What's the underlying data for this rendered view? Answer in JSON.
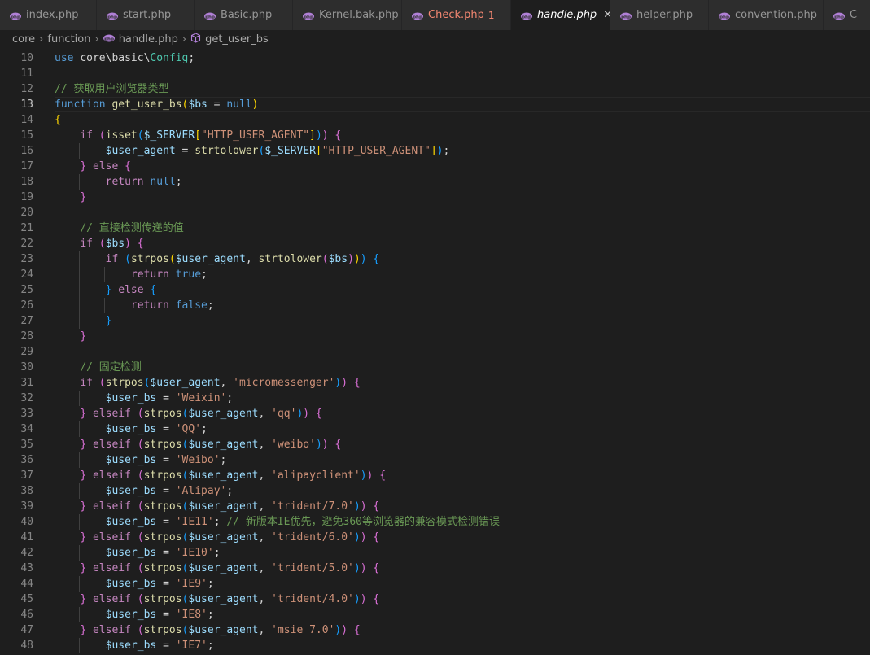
{
  "tabs": [
    {
      "label": "index.php",
      "active": false,
      "error": false
    },
    {
      "label": "start.php",
      "active": false,
      "error": false
    },
    {
      "label": "Basic.php",
      "active": false,
      "error": false
    },
    {
      "label": "Kernel.bak.php",
      "active": false,
      "error": false
    },
    {
      "label": "Check.php",
      "active": false,
      "error": true,
      "badge": "1"
    },
    {
      "label": "handle.php",
      "active": true,
      "error": false,
      "close": "✕"
    },
    {
      "label": "helper.php",
      "active": false,
      "error": false
    },
    {
      "label": "convention.php",
      "active": false,
      "error": false
    },
    {
      "label": "C",
      "active": false,
      "error": false
    }
  ],
  "breadcrumb": {
    "root": "core",
    "folder": "function",
    "file": "handle.php",
    "symbol": "get_user_bs"
  },
  "editor": {
    "current_line": 13,
    "lines": [
      {
        "n": "10",
        "t": [
          [
            "use ",
            "kw"
          ],
          [
            "core\\basic\\",
            "op"
          ],
          [
            "Config",
            "cls"
          ],
          [
            ";",
            "op"
          ]
        ]
      },
      {
        "n": "11",
        "t": []
      },
      {
        "n": "12",
        "t": [
          [
            "// 获取用户浏览器类型",
            "cmt"
          ]
        ]
      },
      {
        "n": "13",
        "t": [
          [
            "function ",
            "kw"
          ],
          [
            "get_user_bs",
            "fn"
          ],
          [
            "(",
            "p0"
          ],
          [
            "$bs",
            "var"
          ],
          [
            " = ",
            "op"
          ],
          [
            "null",
            "kw"
          ],
          [
            ")",
            "p0"
          ]
        ]
      },
      {
        "n": "14",
        "t": [
          [
            "{",
            "p0"
          ]
        ]
      },
      {
        "n": "15",
        "t": [
          [
            "    ",
            "op"
          ],
          [
            "if ",
            "ctl"
          ],
          [
            "(",
            "p1"
          ],
          [
            "isset",
            "fn"
          ],
          [
            "(",
            "p2"
          ],
          [
            "$_SERVER",
            "var"
          ],
          [
            "[",
            "p0"
          ],
          [
            "\"HTTP_USER_AGENT\"",
            "str"
          ],
          [
            "]",
            "p0"
          ],
          [
            ")",
            "p2"
          ],
          [
            ")",
            "p1"
          ],
          [
            " {",
            "p1"
          ]
        ]
      },
      {
        "n": "16",
        "t": [
          [
            "        ",
            "op"
          ],
          [
            "$user_agent",
            "var"
          ],
          [
            " = ",
            "op"
          ],
          [
            "strtolower",
            "fn"
          ],
          [
            "(",
            "p2"
          ],
          [
            "$_SERVER",
            "var"
          ],
          [
            "[",
            "p0"
          ],
          [
            "\"HTTP_USER_AGENT\"",
            "str"
          ],
          [
            "]",
            "p0"
          ],
          [
            ")",
            "p2"
          ],
          [
            ";",
            "op"
          ]
        ]
      },
      {
        "n": "17",
        "t": [
          [
            "    ",
            "op"
          ],
          [
            "}",
            "p1"
          ],
          [
            " else ",
            "ctl"
          ],
          [
            "{",
            "p1"
          ]
        ]
      },
      {
        "n": "18",
        "t": [
          [
            "        ",
            "op"
          ],
          [
            "return ",
            "ctl"
          ],
          [
            "null",
            "kw"
          ],
          [
            ";",
            "op"
          ]
        ]
      },
      {
        "n": "19",
        "t": [
          [
            "    ",
            "op"
          ],
          [
            "}",
            "p1"
          ]
        ]
      },
      {
        "n": "20",
        "t": []
      },
      {
        "n": "21",
        "t": [
          [
            "    ",
            "op"
          ],
          [
            "// 直接检测传递的值",
            "cmt"
          ]
        ]
      },
      {
        "n": "22",
        "t": [
          [
            "    ",
            "op"
          ],
          [
            "if ",
            "ctl"
          ],
          [
            "(",
            "p1"
          ],
          [
            "$bs",
            "var"
          ],
          [
            ")",
            "p1"
          ],
          [
            " {",
            "p1"
          ]
        ]
      },
      {
        "n": "23",
        "t": [
          [
            "        ",
            "op"
          ],
          [
            "if ",
            "ctl"
          ],
          [
            "(",
            "p2"
          ],
          [
            "strpos",
            "fn"
          ],
          [
            "(",
            "p0"
          ],
          [
            "$user_agent",
            "var"
          ],
          [
            ", ",
            "op"
          ],
          [
            "strtolower",
            "fn"
          ],
          [
            "(",
            "p1"
          ],
          [
            "$bs",
            "var"
          ],
          [
            ")",
            "p1"
          ],
          [
            ")",
            "p0"
          ],
          [
            ")",
            "p2"
          ],
          [
            " {",
            "p2"
          ]
        ]
      },
      {
        "n": "24",
        "t": [
          [
            "            ",
            "op"
          ],
          [
            "return ",
            "ctl"
          ],
          [
            "true",
            "kw"
          ],
          [
            ";",
            "op"
          ]
        ]
      },
      {
        "n": "25",
        "t": [
          [
            "        ",
            "op"
          ],
          [
            "}",
            "p2"
          ],
          [
            " else ",
            "ctl"
          ],
          [
            "{",
            "p2"
          ]
        ]
      },
      {
        "n": "26",
        "t": [
          [
            "            ",
            "op"
          ],
          [
            "return ",
            "ctl"
          ],
          [
            "false",
            "kw"
          ],
          [
            ";",
            "op"
          ]
        ]
      },
      {
        "n": "27",
        "t": [
          [
            "        ",
            "op"
          ],
          [
            "}",
            "p2"
          ]
        ]
      },
      {
        "n": "28",
        "t": [
          [
            "    ",
            "op"
          ],
          [
            "}",
            "p1"
          ]
        ]
      },
      {
        "n": "29",
        "t": []
      },
      {
        "n": "30",
        "t": [
          [
            "    ",
            "op"
          ],
          [
            "// 固定检测",
            "cmt"
          ]
        ]
      },
      {
        "n": "31",
        "t": [
          [
            "    ",
            "op"
          ],
          [
            "if ",
            "ctl"
          ],
          [
            "(",
            "p1"
          ],
          [
            "strpos",
            "fn"
          ],
          [
            "(",
            "p2"
          ],
          [
            "$user_agent",
            "var"
          ],
          [
            ", ",
            "op"
          ],
          [
            "'micromessenger'",
            "str"
          ],
          [
            ")",
            "p2"
          ],
          [
            ")",
            "p1"
          ],
          [
            " {",
            "p1"
          ]
        ]
      },
      {
        "n": "32",
        "t": [
          [
            "        ",
            "op"
          ],
          [
            "$user_bs",
            "var"
          ],
          [
            " = ",
            "op"
          ],
          [
            "'Weixin'",
            "str"
          ],
          [
            ";",
            "op"
          ]
        ]
      },
      {
        "n": "33",
        "t": [
          [
            "    ",
            "op"
          ],
          [
            "}",
            "p1"
          ],
          [
            " elseif ",
            "ctl"
          ],
          [
            "(",
            "p1"
          ],
          [
            "strpos",
            "fn"
          ],
          [
            "(",
            "p2"
          ],
          [
            "$user_agent",
            "var"
          ],
          [
            ", ",
            "op"
          ],
          [
            "'qq'",
            "str"
          ],
          [
            ")",
            "p2"
          ],
          [
            ")",
            "p1"
          ],
          [
            " {",
            "p1"
          ]
        ]
      },
      {
        "n": "34",
        "t": [
          [
            "        ",
            "op"
          ],
          [
            "$user_bs",
            "var"
          ],
          [
            " = ",
            "op"
          ],
          [
            "'QQ'",
            "str"
          ],
          [
            ";",
            "op"
          ]
        ]
      },
      {
        "n": "35",
        "t": [
          [
            "    ",
            "op"
          ],
          [
            "}",
            "p1"
          ],
          [
            " elseif ",
            "ctl"
          ],
          [
            "(",
            "p1"
          ],
          [
            "strpos",
            "fn"
          ],
          [
            "(",
            "p2"
          ],
          [
            "$user_agent",
            "var"
          ],
          [
            ", ",
            "op"
          ],
          [
            "'weibo'",
            "str"
          ],
          [
            ")",
            "p2"
          ],
          [
            ")",
            "p1"
          ],
          [
            " {",
            "p1"
          ]
        ]
      },
      {
        "n": "36",
        "t": [
          [
            "        ",
            "op"
          ],
          [
            "$user_bs",
            "var"
          ],
          [
            " = ",
            "op"
          ],
          [
            "'Weibo'",
            "str"
          ],
          [
            ";",
            "op"
          ]
        ]
      },
      {
        "n": "37",
        "t": [
          [
            "    ",
            "op"
          ],
          [
            "}",
            "p1"
          ],
          [
            " elseif ",
            "ctl"
          ],
          [
            "(",
            "p1"
          ],
          [
            "strpos",
            "fn"
          ],
          [
            "(",
            "p2"
          ],
          [
            "$user_agent",
            "var"
          ],
          [
            ", ",
            "op"
          ],
          [
            "'alipayclient'",
            "str"
          ],
          [
            ")",
            "p2"
          ],
          [
            ")",
            "p1"
          ],
          [
            " {",
            "p1"
          ]
        ]
      },
      {
        "n": "38",
        "t": [
          [
            "        ",
            "op"
          ],
          [
            "$user_bs",
            "var"
          ],
          [
            " = ",
            "op"
          ],
          [
            "'Alipay'",
            "str"
          ],
          [
            ";",
            "op"
          ]
        ]
      },
      {
        "n": "39",
        "t": [
          [
            "    ",
            "op"
          ],
          [
            "}",
            "p1"
          ],
          [
            " elseif ",
            "ctl"
          ],
          [
            "(",
            "p1"
          ],
          [
            "strpos",
            "fn"
          ],
          [
            "(",
            "p2"
          ],
          [
            "$user_agent",
            "var"
          ],
          [
            ", ",
            "op"
          ],
          [
            "'trident/7.0'",
            "str"
          ],
          [
            ")",
            "p2"
          ],
          [
            ")",
            "p1"
          ],
          [
            " {",
            "p1"
          ]
        ]
      },
      {
        "n": "40",
        "t": [
          [
            "        ",
            "op"
          ],
          [
            "$user_bs",
            "var"
          ],
          [
            " = ",
            "op"
          ],
          [
            "'IE11'",
            "str"
          ],
          [
            "; ",
            "op"
          ],
          [
            "// 新版本IE优先，避免360等浏览器的兼容模式检测错误",
            "cmt"
          ]
        ]
      },
      {
        "n": "41",
        "t": [
          [
            "    ",
            "op"
          ],
          [
            "}",
            "p1"
          ],
          [
            " elseif ",
            "ctl"
          ],
          [
            "(",
            "p1"
          ],
          [
            "strpos",
            "fn"
          ],
          [
            "(",
            "p2"
          ],
          [
            "$user_agent",
            "var"
          ],
          [
            ", ",
            "op"
          ],
          [
            "'trident/6.0'",
            "str"
          ],
          [
            ")",
            "p2"
          ],
          [
            ")",
            "p1"
          ],
          [
            " {",
            "p1"
          ]
        ]
      },
      {
        "n": "42",
        "t": [
          [
            "        ",
            "op"
          ],
          [
            "$user_bs",
            "var"
          ],
          [
            " = ",
            "op"
          ],
          [
            "'IE10'",
            "str"
          ],
          [
            ";",
            "op"
          ]
        ]
      },
      {
        "n": "43",
        "t": [
          [
            "    ",
            "op"
          ],
          [
            "}",
            "p1"
          ],
          [
            " elseif ",
            "ctl"
          ],
          [
            "(",
            "p1"
          ],
          [
            "strpos",
            "fn"
          ],
          [
            "(",
            "p2"
          ],
          [
            "$user_agent",
            "var"
          ],
          [
            ", ",
            "op"
          ],
          [
            "'trident/5.0'",
            "str"
          ],
          [
            ")",
            "p2"
          ],
          [
            ")",
            "p1"
          ],
          [
            " {",
            "p1"
          ]
        ]
      },
      {
        "n": "44",
        "t": [
          [
            "        ",
            "op"
          ],
          [
            "$user_bs",
            "var"
          ],
          [
            " = ",
            "op"
          ],
          [
            "'IE9'",
            "str"
          ],
          [
            ";",
            "op"
          ]
        ]
      },
      {
        "n": "45",
        "t": [
          [
            "    ",
            "op"
          ],
          [
            "}",
            "p1"
          ],
          [
            " elseif ",
            "ctl"
          ],
          [
            "(",
            "p1"
          ],
          [
            "strpos",
            "fn"
          ],
          [
            "(",
            "p2"
          ],
          [
            "$user_agent",
            "var"
          ],
          [
            ", ",
            "op"
          ],
          [
            "'trident/4.0'",
            "str"
          ],
          [
            ")",
            "p2"
          ],
          [
            ")",
            "p1"
          ],
          [
            " {",
            "p1"
          ]
        ]
      },
      {
        "n": "46",
        "t": [
          [
            "        ",
            "op"
          ],
          [
            "$user_bs",
            "var"
          ],
          [
            " = ",
            "op"
          ],
          [
            "'IE8'",
            "str"
          ],
          [
            ";",
            "op"
          ]
        ]
      },
      {
        "n": "47",
        "t": [
          [
            "    ",
            "op"
          ],
          [
            "}",
            "p1"
          ],
          [
            " elseif ",
            "ctl"
          ],
          [
            "(",
            "p1"
          ],
          [
            "strpos",
            "fn"
          ],
          [
            "(",
            "p2"
          ],
          [
            "$user_agent",
            "var"
          ],
          [
            ", ",
            "op"
          ],
          [
            "'msie 7.0'",
            "str"
          ],
          [
            ")",
            "p2"
          ],
          [
            ")",
            "p1"
          ],
          [
            " {",
            "p1"
          ]
        ]
      },
      {
        "n": "48",
        "t": [
          [
            "        ",
            "op"
          ],
          [
            "$user_bs",
            "var"
          ],
          [
            " = ",
            "op"
          ],
          [
            "'IE7'",
            "str"
          ],
          [
            ";",
            "op"
          ]
        ]
      }
    ]
  }
}
